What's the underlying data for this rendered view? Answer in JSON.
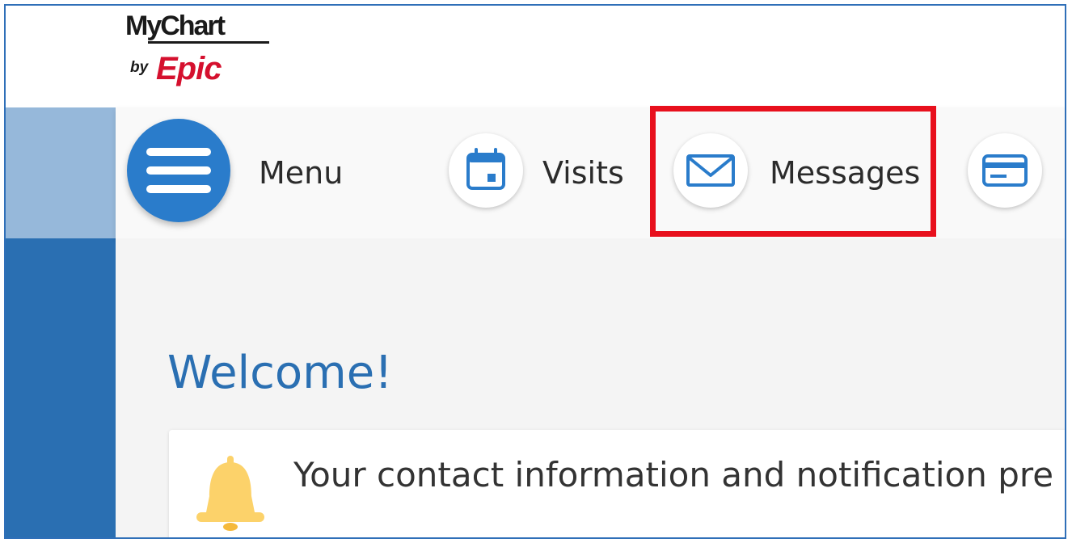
{
  "brand": {
    "logo_mychart": "MyChart",
    "logo_by": "by",
    "logo_epic": "Epic"
  },
  "nav": {
    "items": [
      {
        "label": "Menu",
        "icon": "hamburger-menu-icon"
      },
      {
        "label": "Visits",
        "icon": "calendar-icon"
      },
      {
        "label": "Messages",
        "icon": "envelope-icon",
        "highlighted": true
      },
      {
        "label": "",
        "icon": "credit-card-icon"
      }
    ]
  },
  "main": {
    "welcome": "Welcome!",
    "notice": {
      "icon": "bell-icon",
      "text": "Your contact information and notification pre"
    }
  },
  "colors": {
    "accent": "#2a7ccb",
    "heading": "#2a6fb2",
    "sidebar_light": "#96b8da",
    "sidebar_dark": "#2a6fb2",
    "highlight": "#e8101d",
    "epic_red": "#d5102e",
    "bell": "#fcd26a"
  }
}
